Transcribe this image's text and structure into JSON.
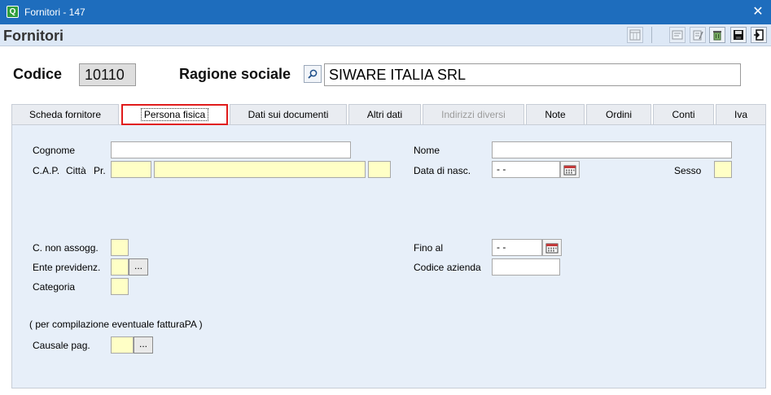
{
  "window": {
    "title": "Fornitori - 147",
    "close_symbol": "✕",
    "app_icon_letter": "Q"
  },
  "header": {
    "page_title": "Fornitori"
  },
  "toolbar": {
    "icons": [
      "columns-icon",
      "report-icon",
      "edit-document-icon",
      "recycle-bin-icon",
      "save-disk-icon",
      "exit-door-icon"
    ]
  },
  "record": {
    "codice_label": "Codice",
    "codice_value": "10110",
    "ragione_label": "Ragione sociale",
    "ragione_value": "SIWARE ITALIA SRL"
  },
  "tabs": [
    {
      "label": "Scheda fornitore",
      "state": "normal"
    },
    {
      "label": "Persona fisica",
      "state": "active"
    },
    {
      "label": "Dati sui documenti",
      "state": "normal"
    },
    {
      "label": "Altri dati",
      "state": "normal"
    },
    {
      "label": "Indirizzi diversi",
      "state": "disabled"
    },
    {
      "label": "Note",
      "state": "normal"
    },
    {
      "label": "Ordini",
      "state": "normal"
    },
    {
      "label": "Conti",
      "state": "normal"
    },
    {
      "label": "Iva",
      "state": "normal"
    }
  ],
  "form": {
    "cognome_label": "Cognome",
    "cognome_value": "",
    "cap_label": "C.A.P.",
    "citta_label": "Città",
    "pr_label": "Pr.",
    "nome_label": "Nome",
    "nome_value": "",
    "data_nasc_label": "Data di nasc.",
    "data_nasc_value": "- -",
    "sesso_label": "Sesso",
    "non_assogg_label": "C. non assogg.",
    "ente_label": "Ente previdenz.",
    "categoria_label": "Categoria",
    "fino_label": "Fino al",
    "fino_value": "- -",
    "codice_azienda_label": "Codice azienda",
    "fattura_note": "( per compilazione eventuale fatturaPA )",
    "causale_label": "Causale pag.",
    "ellipsis": "..."
  },
  "colors": {
    "titlebar": "#1e6dbd",
    "header": "#dde8f6",
    "panel": "#e7eff9",
    "required_field": "#ffffc6",
    "active_tab_outline": "#e01b1b"
  }
}
